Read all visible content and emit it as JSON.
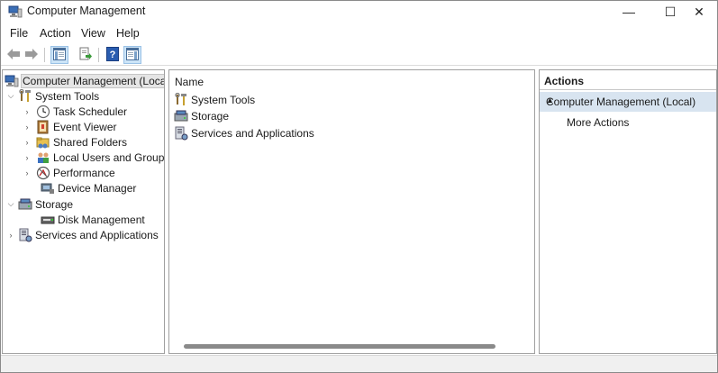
{
  "window": {
    "title": "Computer Management",
    "controls": {
      "minimize": "—",
      "maximize": "☐",
      "close": "✕"
    }
  },
  "menu": [
    "File",
    "Action",
    "View",
    "Help"
  ],
  "toolbar": {
    "buttons": [
      "back-arrow-icon",
      "forward-arrow-icon",
      "show-hide-console-tree-icon",
      "export-list-icon",
      "help-icon",
      "show-hide-action-pane-icon"
    ]
  },
  "tree": {
    "root": "Computer Management (Local)",
    "items": [
      {
        "label": "System Tools",
        "level": 1,
        "expanded": true
      },
      {
        "label": "Task Scheduler",
        "level": 2
      },
      {
        "label": "Event Viewer",
        "level": 2
      },
      {
        "label": "Shared Folders",
        "level": 2
      },
      {
        "label": "Local Users and Groups",
        "level": 2
      },
      {
        "label": "Performance",
        "level": 2
      },
      {
        "label": "Device Manager",
        "level": 2
      },
      {
        "label": "Storage",
        "level": 1,
        "expanded": true
      },
      {
        "label": "Disk Management",
        "level": 2
      },
      {
        "label": "Services and Applications",
        "level": 1
      }
    ]
  },
  "main": {
    "column_header": "Name",
    "rows": [
      "System Tools",
      "Storage",
      "Services and Applications"
    ]
  },
  "actions": {
    "header": "Actions",
    "section": "Computer Management (Local)",
    "links": [
      "More Actions"
    ]
  },
  "colors": {
    "selection": "#cce4f7",
    "section_bg": "#d8e4f0",
    "border": "#a0a0a0"
  }
}
